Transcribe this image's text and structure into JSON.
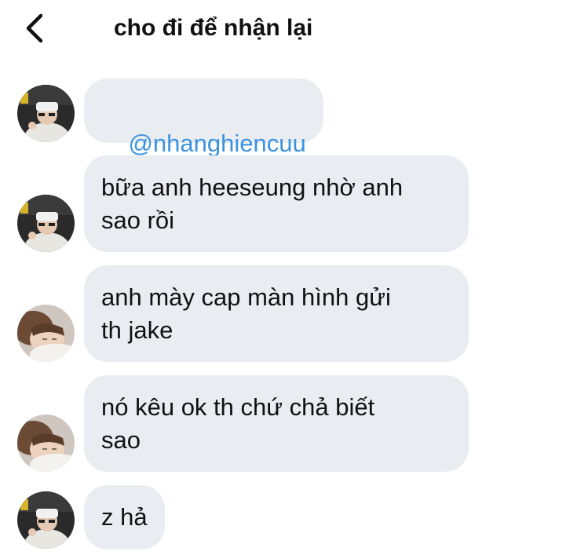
{
  "header": {
    "title": "cho đi để nhận lại",
    "back_icon": "chevron-left-icon"
  },
  "colors": {
    "bubble": "#e9ecf0",
    "mention": "#3b93e0"
  },
  "messages": [
    {
      "sender": "a",
      "text": "@nhanghiencuu",
      "is_mention": true
    },
    {
      "sender": "a",
      "text": "bữa anh heeseung nhờ anh\nsao rồi"
    },
    {
      "sender": "b",
      "text": "anh mày cap màn hình gửi\nth jake"
    },
    {
      "sender": "b",
      "text": "nó kêu ok th chứ chả biết\nsao"
    },
    {
      "sender": "a",
      "text": "z hả"
    }
  ]
}
